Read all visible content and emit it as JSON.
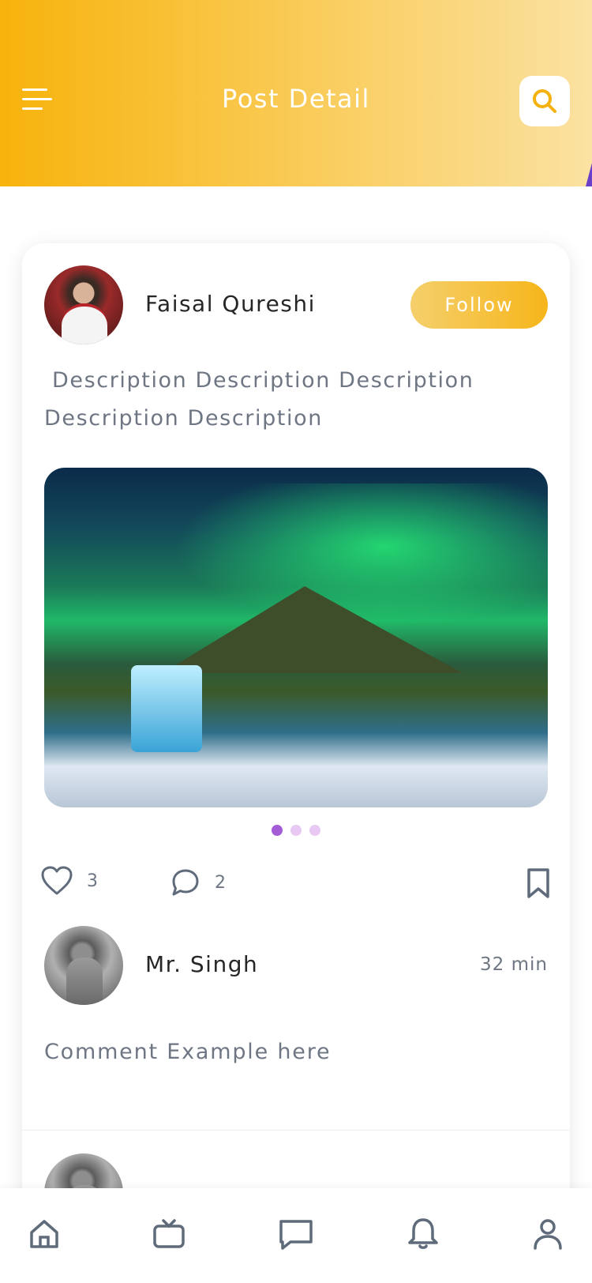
{
  "header": {
    "title": "Post Detail",
    "menu_icon": "menu-icon",
    "search_icon": "search-icon",
    "gradient_start": "#f8b30c",
    "gradient_end": "#fbe2a2"
  },
  "post": {
    "author_name": "Faisal Qureshi",
    "follow_label": "Follow",
    "description": "Description Description Description Description Description",
    "image_icon": "landscape-photo",
    "carousel": {
      "total": 3,
      "active_index": 0,
      "active_color": "#a35bd6",
      "inactive_color": "#e8c9f3"
    },
    "likes_count": "3",
    "comments_count": "2"
  },
  "comments": [
    {
      "author": "Mr. Singh",
      "time": "32 min",
      "text": "Comment Example here"
    }
  ],
  "bottom_nav": [
    {
      "icon": "home-icon"
    },
    {
      "icon": "tv-icon"
    },
    {
      "icon": "chat-icon"
    },
    {
      "icon": "bell-icon"
    },
    {
      "icon": "profile-icon"
    }
  ]
}
